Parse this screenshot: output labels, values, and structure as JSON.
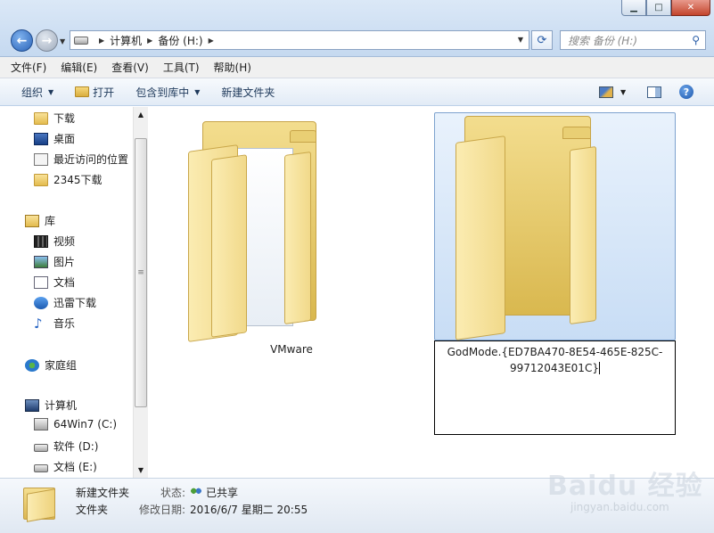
{
  "window": {
    "min_glyph": "▁",
    "max_glyph": "□",
    "close_glyph": "✕"
  },
  "address": {
    "crumbs": [
      "计算机",
      "备份 (H:)"
    ]
  },
  "search": {
    "placeholder": "搜索 备份 (H:)"
  },
  "menu": [
    "文件(F)",
    "编辑(E)",
    "查看(V)",
    "工具(T)",
    "帮助(H)"
  ],
  "toolbar": {
    "organize": "组织",
    "open": "打开",
    "include_library": "包含到库中",
    "new_folder": "新建文件夹",
    "help": "?"
  },
  "nav": {
    "favorites": [
      "下载",
      "桌面",
      "最近访问的位置",
      "2345下载"
    ],
    "library": "库",
    "library_items": [
      "视频",
      "图片",
      "文档",
      "迅雷下载",
      "音乐"
    ],
    "homegroup": "家庭组",
    "computer": "计算机",
    "drives": [
      "64Win7  (C:)",
      "软件 (D:)",
      "文档 (E:)"
    ]
  },
  "content": {
    "items": [
      {
        "name": "VMware"
      },
      {
        "name_line1": "GodMode.{ED7BA470-8E54-465E-825C-",
        "name_line2": "99712043E01C}"
      }
    ]
  },
  "details": {
    "name": "新建文件夹",
    "type": "文件夹",
    "status_key": "状态:",
    "status_value": "已共享",
    "modified_key": "修改日期:",
    "modified_value": "2016/6/7 星期二 20:55"
  },
  "watermark": {
    "logo": "Baidu 经验",
    "url": "jingyan.baidu.com"
  }
}
